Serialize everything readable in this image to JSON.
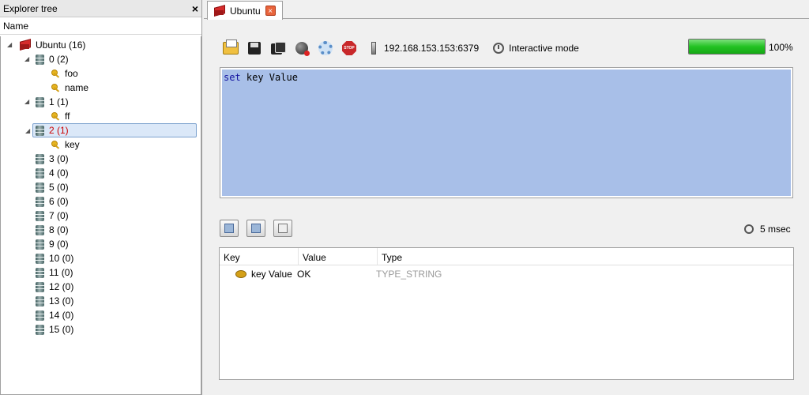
{
  "explorer": {
    "title": "Explorer tree",
    "close": "×",
    "column_header": "Name",
    "server": {
      "label": "Ubuntu (16)"
    },
    "databases": [
      {
        "label": "0 (2)",
        "keys": [
          "foo",
          "name"
        ],
        "expanded": true
      },
      {
        "label": "1 (1)",
        "keys": [
          "ff"
        ],
        "expanded": true
      },
      {
        "label": "2 (1)",
        "keys": [
          "key"
        ],
        "expanded": true,
        "selected": true
      },
      {
        "label": "3 (0)"
      },
      {
        "label": "4 (0)"
      },
      {
        "label": "5 (0)"
      },
      {
        "label": "6 (0)"
      },
      {
        "label": "7 (0)"
      },
      {
        "label": "8 (0)"
      },
      {
        "label": "9 (0)"
      },
      {
        "label": "10 (0)"
      },
      {
        "label": "11 (0)"
      },
      {
        "label": "12 (0)"
      },
      {
        "label": "13 (0)"
      },
      {
        "label": "14 (0)"
      },
      {
        "label": "15 (0)"
      }
    ]
  },
  "tab": {
    "label": "Ubuntu",
    "close": "×"
  },
  "toolbar": {
    "connection": "192.168.153.153:6379",
    "mode": "Interactive mode",
    "stop_icon_text": "STOP",
    "progress": 100,
    "progress_label": "100%"
  },
  "editor": {
    "keyword": "set",
    "rest": " key Value"
  },
  "timer": {
    "label": "5 msec"
  },
  "results": {
    "columns": [
      "Key",
      "Value",
      "Type"
    ],
    "rows": [
      {
        "key": "key Value",
        "value": "OK",
        "type": "TYPE_STRING"
      }
    ]
  },
  "colors": {
    "progress": "#22c222",
    "selection": "#a8bfe8",
    "accent_red": "#cc0000"
  }
}
